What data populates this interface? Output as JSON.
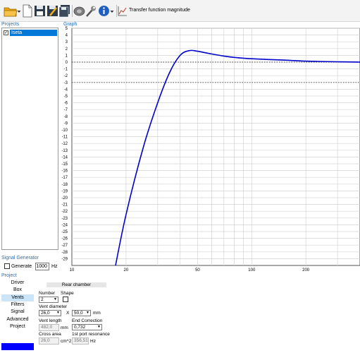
{
  "toolbar": {
    "transfer_label": "Transfer function magnitude",
    "icons": [
      "open-folder-icon",
      "dropdown-arrow-icon",
      "new-document-icon",
      "save-icon",
      "save-as-icon",
      "save-all-icon",
      "speaker-icon",
      "wrench-icon",
      "info-icon",
      "chart-icon"
    ]
  },
  "sections": {
    "projects": "Projects",
    "graph": "Graph",
    "signal_generator": "Signal Generator",
    "project": "Project"
  },
  "project_tree": {
    "item_label": "Iseta",
    "item_checked": true
  },
  "signal_generator": {
    "generate_label": "Generate",
    "frequency": "1000",
    "unit": "Hz"
  },
  "nav_tabs": [
    "Driver",
    "Box",
    "Vents",
    "Filters",
    "Signal",
    "Advanced",
    "Project"
  ],
  "active_tab": "Vents",
  "vents": {
    "header": "Rear chamber",
    "number_label": "Number",
    "number_value": "2",
    "shape_label": "Shape",
    "vent_diameter_label": "Vent diameter",
    "vent_diameter_value": "26,0",
    "x_label": "X",
    "vent_diameter2_value": "50,0",
    "mm_label": "mm",
    "vent_length_label": "Vent length",
    "vent_length_value": "482,0",
    "vent_length_unit": "mm",
    "end_correction_label": "End Correction",
    "end_correction_value": "0,732",
    "cross_area_label": "Cross area",
    "cross_area_value": "26,0",
    "cross_area_unit": "cm^2",
    "port_resonance_label": "1st port resonance",
    "port_resonance_value": "356,51",
    "port_resonance_unit": "Hz"
  },
  "chart_data": {
    "type": "line",
    "title": "",
    "xlabel": "",
    "ylabel": "",
    "x_scale": "log",
    "xlim": [
      10,
      400
    ],
    "ylim": [
      -30,
      5
    ],
    "x_ticks": [
      10,
      20,
      50,
      100,
      200
    ],
    "y_ticks": [
      5,
      4,
      3,
      2,
      1,
      0,
      -1,
      -2,
      -3,
      -4,
      -5,
      -6,
      -7,
      -8,
      -9,
      -10,
      -11,
      -12,
      -13,
      -14,
      -15,
      -16,
      -17,
      -18,
      -19,
      -20,
      -21,
      -22,
      -23,
      -24,
      -25,
      -26,
      -27,
      -28,
      -29
    ],
    "reference_lines": [
      0,
      -3
    ],
    "grid": true,
    "series": [
      {
        "color": "#0000cc",
        "x": [
          17.5,
          20,
          25,
          30,
          35,
          40,
          45,
          50,
          60,
          70,
          80,
          100,
          150,
          200,
          300,
          400
        ],
        "y": [
          -30,
          -22.5,
          -12.5,
          -6,
          -1.5,
          1.0,
          1.7,
          1.6,
          1.2,
          0.9,
          0.7,
          0.5,
          0.3,
          0.15,
          0.05,
          0.0
        ]
      }
    ]
  }
}
